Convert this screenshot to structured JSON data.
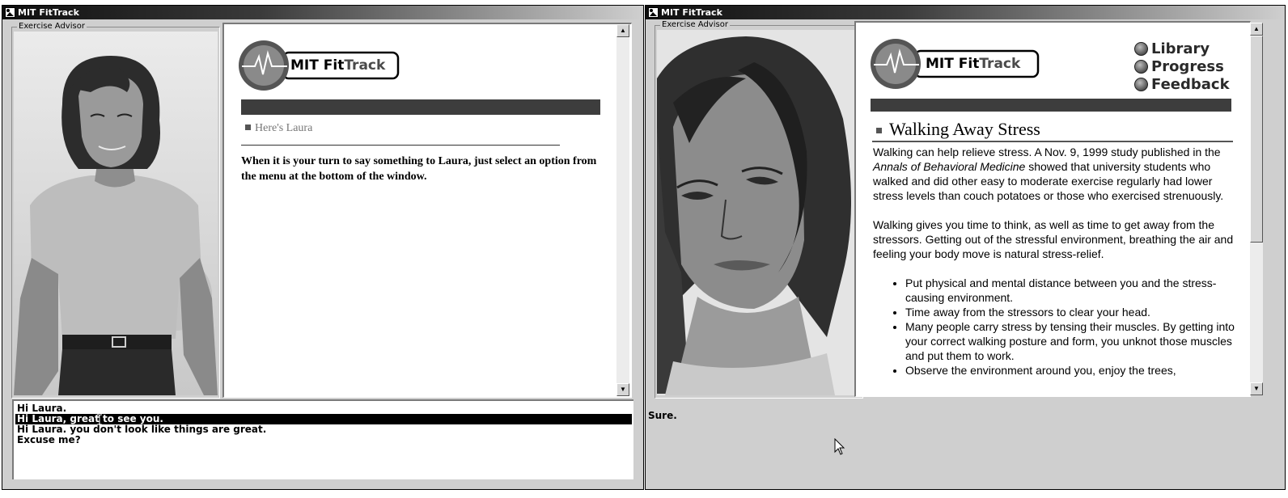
{
  "left_window": {
    "title": "MIT FitTrack",
    "advisor_label": "Exercise Advisor",
    "logo_text_a": "MIT Fit",
    "logo_text_b": "Track",
    "breadcrumb": "Here's Laura",
    "instructions": "When it is your turn to say something to Laura, just select an option from the menu at the bottom of the window.",
    "menu_options": [
      "Hi Laura.",
      "Hi Laura, great to see you.",
      "Hi Laura. you don't look like things are great.",
      "Excuse me?"
    ],
    "selected_index": 1
  },
  "right_window": {
    "title": "MIT FitTrack",
    "advisor_label": "Exercise Advisor",
    "logo_text_a": "MIT Fit",
    "logo_text_b": "Track",
    "nav": [
      "Library",
      "Progress",
      "Feedback"
    ],
    "article_title": "Walking Away Stress",
    "para1_a": "Walking can help relieve stress.  A Nov. 9, 1999 study published in the ",
    "para1_em": "Annals of  Behavioral Medicine",
    "para1_b": " showed that university students who walked and did other easy to moderate exercise regularly had lower stress levels than couch potatoes or those who exercised strenuously.",
    "para2": "Walking gives you time to think, as well as time to get away from the stressors.  Getting out of the stressful environment, breathing the air and feeling your body move is natural stress-relief.",
    "bullets": [
      "Put physical and mental distance between you and the stress-causing environment.",
      "Time away from the stressors to clear your head.",
      "Many people carry stress by tensing their muscles.  By getting into your correct walking posture and form, you unknot those muscles and put them to work.",
      "Observe the environment around you, enjoy the trees,"
    ],
    "reply": "Sure."
  },
  "colors": {
    "window_bg": "#cfcfcf",
    "header_bar": "#3d3d3d",
    "selection": "#000000"
  }
}
